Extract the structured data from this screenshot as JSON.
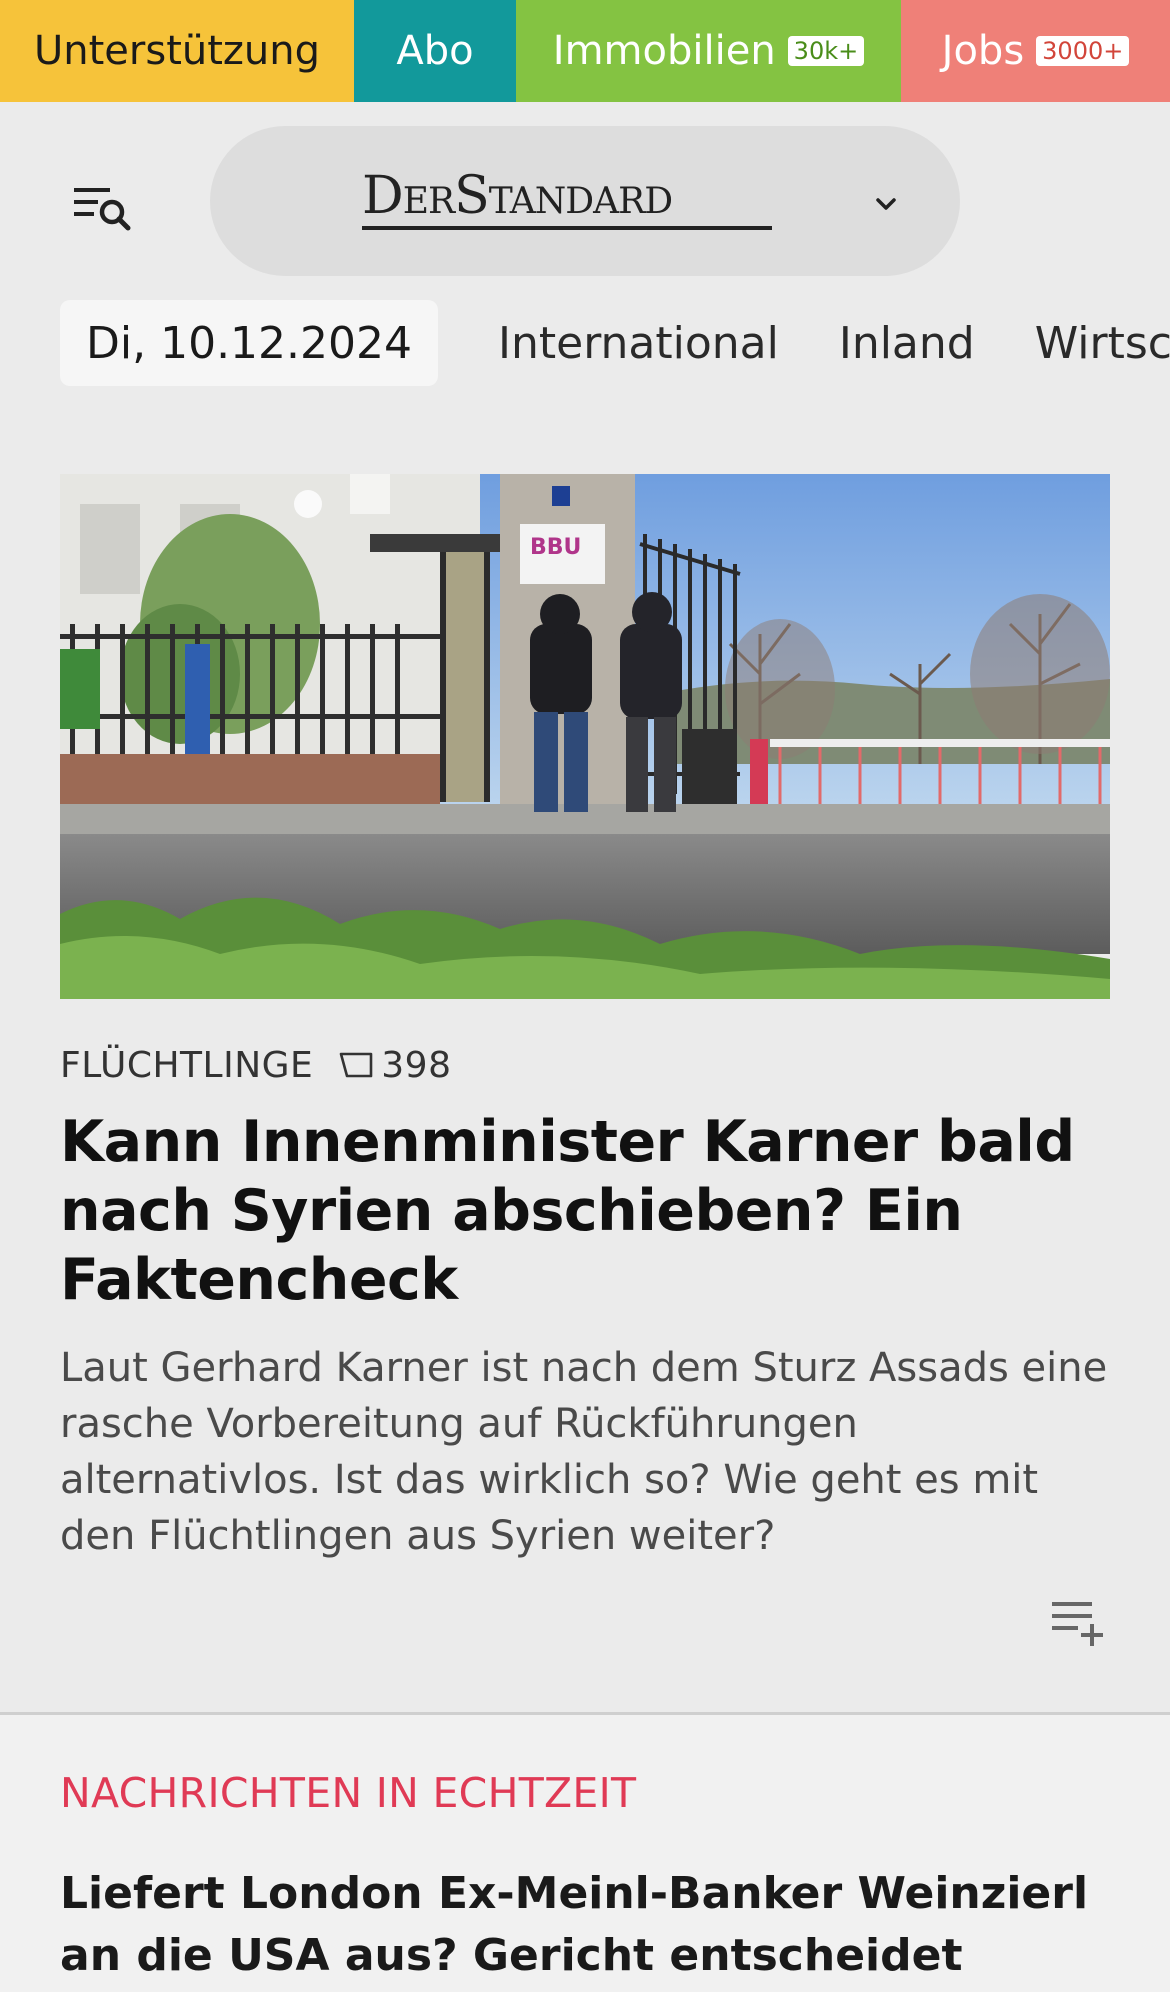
{
  "topnav": {
    "support_label": "Unterstützung",
    "abo_label": "Abo",
    "immobilien_label": "Immobilien",
    "immobilien_badge": "30k+",
    "jobs_label": "Jobs",
    "jobs_badge": "3000+"
  },
  "header": {
    "logo_text": "DerStandard"
  },
  "tabs": {
    "date": "Di, 10.12.2024",
    "items": [
      "International",
      "Inland",
      "Wirtschaft"
    ]
  },
  "lead": {
    "kicker": "FLÜCHTLINGE",
    "comment_count": "398",
    "headline": "Kann Innenminister Karner bald nach Syrien abschieben? Ein Faktencheck",
    "teaser": "Laut Gerhard Karner ist nach dem Sturz Assads eine rasche Vorbereitung auf Rückführungen alternativlos. Ist das wirklich so? Wie geht es mit den Flüchtlingen aus Syrien weiter?",
    "sign_text": "BBU"
  },
  "live": {
    "label": "NACHRICHTEN IN ECHTZEIT",
    "headline": "Liefert London Ex-Meinl-Banker Weinzierl an die USA aus? Gericht entscheidet frühestens im"
  },
  "colors": {
    "support": "#f6c33a",
    "abo": "#12999b",
    "immobilien": "#84c342",
    "jobs": "#ef8078",
    "live_accent": "#e03a55"
  },
  "icons": [
    "menu-search-icon",
    "chevron-down-icon",
    "comment-icon",
    "add-to-list-icon"
  ]
}
